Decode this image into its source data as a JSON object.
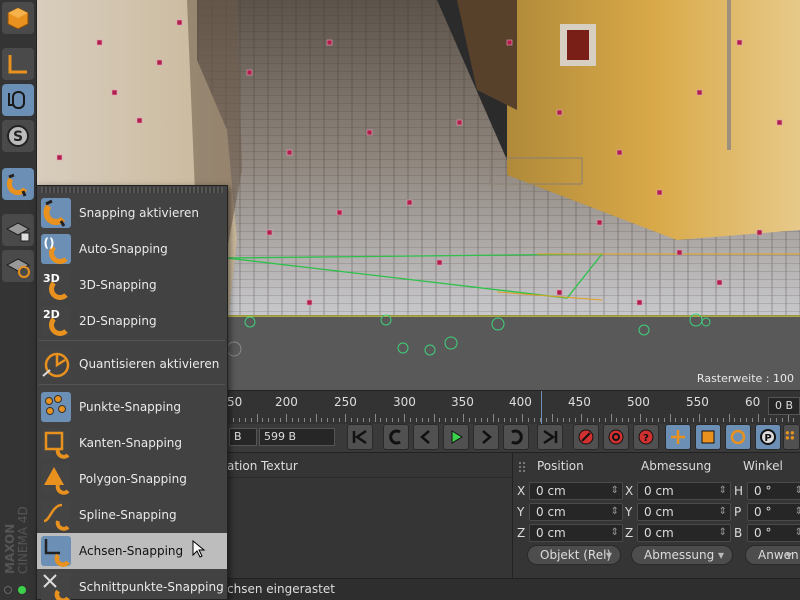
{
  "viewport": {
    "raster_label": "Rasterweite : 100"
  },
  "menu": {
    "items": [
      {
        "label": "Snapping aktivieren",
        "icon": "magnet-icon"
      },
      {
        "label": "Auto-Snapping",
        "icon": "auto-snapping-icon"
      },
      {
        "label": "3D-Snapping",
        "icon": "3d-snapping-icon",
        "badge": "3D"
      },
      {
        "label": "2D-Snapping",
        "icon": "2d-snapping-icon",
        "badge": "2D"
      },
      {
        "label": "Quantisieren aktivieren",
        "icon": "quantize-icon"
      },
      {
        "label": "Punkte-Snapping",
        "icon": "points-snapping-icon"
      },
      {
        "label": "Kanten-Snapping",
        "icon": "edges-snapping-icon"
      },
      {
        "label": "Polygon-Snapping",
        "icon": "polygon-snapping-icon"
      },
      {
        "label": "Spline-Snapping",
        "icon": "spline-snapping-icon"
      },
      {
        "label": "Achsen-Snapping",
        "icon": "axis-snapping-icon"
      },
      {
        "label": "Schnittpunkte-Snapping",
        "icon": "intersection-snapping-icon"
      }
    ]
  },
  "timeline": {
    "ruler": [
      "50",
      "200",
      "250",
      "300",
      "350",
      "400",
      "450",
      "500",
      "550",
      "60"
    ],
    "frame_end": "0 B"
  },
  "transport": {
    "field_left": "B",
    "field_main": "599 B"
  },
  "object_panel": {
    "col_partial": "ation",
    "col_textur": "Textur"
  },
  "coords": {
    "headers": {
      "position": "Position",
      "abmessung": "Abmessung",
      "winkel": "Winkel"
    },
    "rows": [
      {
        "axis1": "X",
        "pos": "0 cm",
        "axis2": "X",
        "size": "0 cm",
        "axis3": "H",
        "angle": "0 °"
      },
      {
        "axis1": "Y",
        "pos": "0 cm",
        "axis2": "Y",
        "size": "0 cm",
        "axis3": "P",
        "angle": "0 °"
      },
      {
        "axis1": "Z",
        "pos": "0 cm",
        "axis2": "Z",
        "size": "0 cm",
        "axis3": "B",
        "angle": "0 °"
      }
    ],
    "dropdown_mode": "Objekt (Rel)",
    "dropdown_size": "Abmessung",
    "apply_button": "Anwen"
  },
  "status": {
    "text": "chsen eingerastet"
  },
  "brand": {
    "line1": "MAXON",
    "line2": "CINEMA 4D"
  },
  "colors": {
    "accent": "#6b8fb5",
    "icon_orange": "#e8911e",
    "hover": "#bdbdbd"
  }
}
